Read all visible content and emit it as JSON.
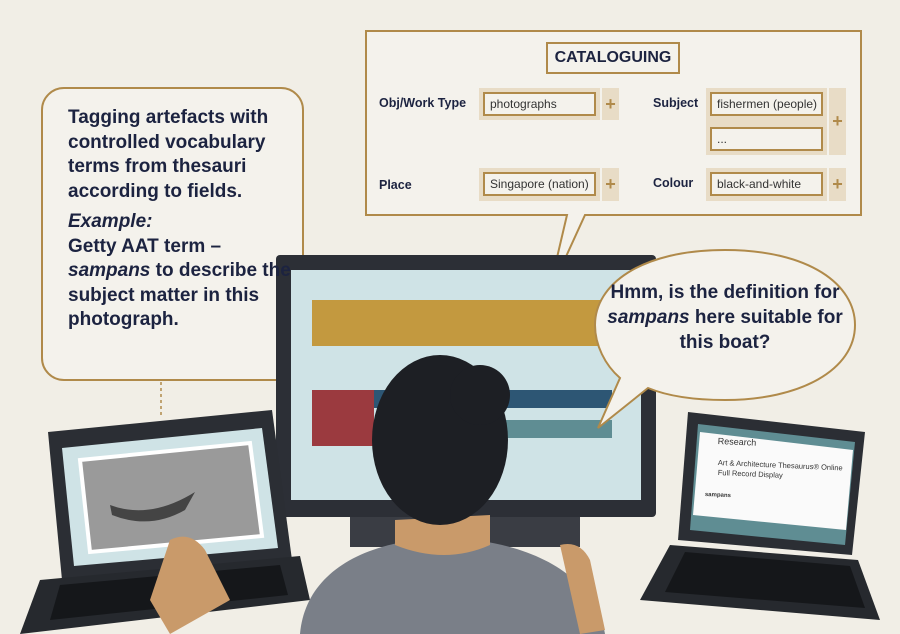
{
  "left_bubble": {
    "line1": "Tagging artefacts with controlled vocabulary terms from thesauri according to fields.",
    "example_label": "Example:",
    "example_pre": "Getty AAT term – ",
    "example_term": "sampans",
    "example_post": " to describe the subject matter in this photograph."
  },
  "right_bubble": {
    "pre": "Hmm, is the definition for ",
    "term": "sampans",
    "post": " here suitable for this boat?"
  },
  "cataloguing": {
    "title": "CATALOGUING",
    "fields": [
      {
        "label": "Obj/Work Type",
        "values": [
          "photographs"
        ]
      },
      {
        "label": "Subject",
        "values": [
          "fishermen (people)",
          "..."
        ]
      },
      {
        "label": "Place",
        "values": [
          "Singapore (nation)"
        ]
      },
      {
        "label": "Colour",
        "values": [
          "black-and-white"
        ]
      }
    ],
    "add_icon": "plus-icon"
  },
  "right_laptop_screen": {
    "header": "Research",
    "title": "Art & Architecture Thesaurus® Online",
    "subtitle": "Full Record Display",
    "term": "sampans"
  },
  "colors": {
    "navy": "#1c2340",
    "gold": "#b08a4a",
    "background": "#f1eee6",
    "screen": "#cfe3e6",
    "red": "#9b3a3f",
    "teal": "#5f8d93"
  }
}
